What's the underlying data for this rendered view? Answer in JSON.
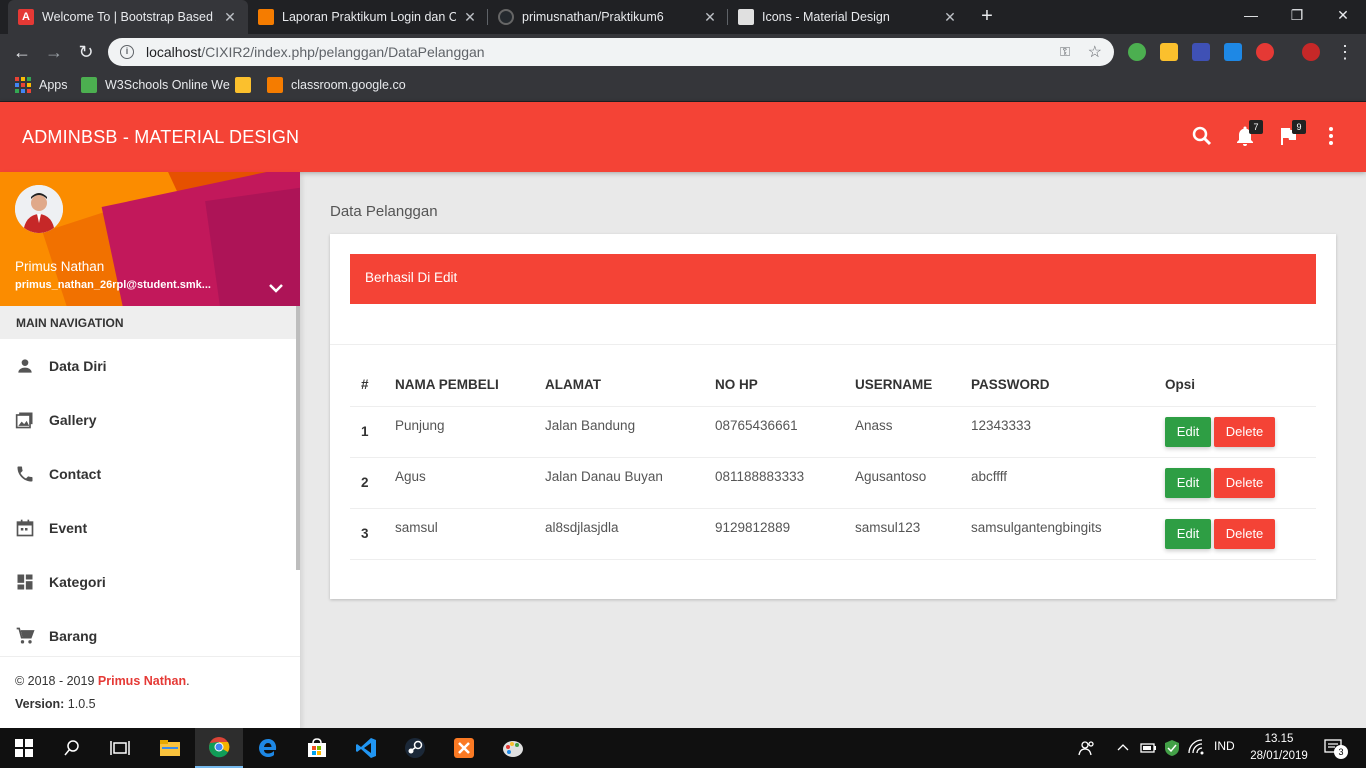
{
  "browser": {
    "tabs": [
      {
        "title": "Welcome To | Bootstrap Based Ad",
        "favicon_color": "#e53935",
        "active": true
      },
      {
        "title": "Laporan Praktikum Login dan CRU",
        "favicon_color": "#f57c00",
        "active": false
      },
      {
        "title": "primusnathan/Praktikum6",
        "favicon_color": "#24292e",
        "active": false
      },
      {
        "title": "Icons - Material Design",
        "favicon_color": "#e0e0e0",
        "active": false
      }
    ],
    "url_host": "localhost",
    "url_path": "/CIXIR2/index.php/pelanggan/DataPelanggan",
    "bookmarks": [
      {
        "label": "Apps"
      },
      {
        "label": "W3Schools Online We"
      },
      {
        "label": ""
      },
      {
        "label": "classroom.google.co"
      }
    ]
  },
  "header": {
    "brand": "ADMINBSB - MATERIAL DESIGN",
    "notifications_count": "7",
    "tasks_count": "9",
    "accent": "#f44336"
  },
  "user": {
    "name": "Primus Nathan",
    "email": "primus_nathan_26rpl@student.smk..."
  },
  "sidebar": {
    "header": "MAIN NAVIGATION",
    "items": [
      {
        "label": "Data Diri",
        "icon": "person-icon"
      },
      {
        "label": "Gallery",
        "icon": "photo-icon"
      },
      {
        "label": "Contact",
        "icon": "phone-icon"
      },
      {
        "label": "Event",
        "icon": "calendar-icon"
      },
      {
        "label": "Kategori",
        "icon": "dashboard-icon"
      },
      {
        "label": "Barang",
        "icon": "cart-icon"
      }
    ],
    "footer": {
      "copyright_prefix": "© 2018 - 2019 ",
      "author": "Primus Nathan",
      "period": ".",
      "version_label": "Version: ",
      "version": "1.0.5"
    }
  },
  "content": {
    "page_title": "Data Pelanggan",
    "alert": "Berhasil Di Edit",
    "columns": [
      "#",
      "NAMA PEMBELI",
      "ALAMAT",
      "NO HP",
      "USERNAME",
      "PASSWORD",
      "Opsi"
    ],
    "rows": [
      {
        "no": "1",
        "nama": "Punjung",
        "alamat": "Jalan Bandung",
        "hp": "08765436661",
        "username": "Anass",
        "password": "12343333"
      },
      {
        "no": "2",
        "nama": "Agus",
        "alamat": "Jalan Danau Buyan",
        "hp": "081188883333",
        "username": "Agusantoso",
        "password": "abcffff"
      },
      {
        "no": "3",
        "nama": "samsul",
        "alamat": "al8sdjlasjdla",
        "hp": "9129812889",
        "username": "samsul123",
        "password": "samsulgantengbingits"
      }
    ],
    "edit_label": "Edit",
    "delete_label": "Delete"
  },
  "taskbar": {
    "lang": "IND",
    "time": "13.15",
    "date": "28/01/2019",
    "notif_count": "3"
  }
}
